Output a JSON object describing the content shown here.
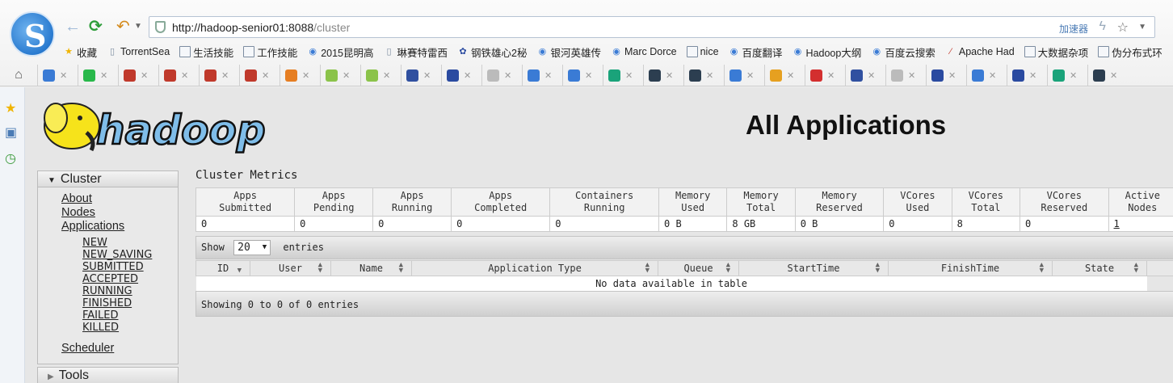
{
  "browser": {
    "url_host": "http://hadoop-senior01:8088",
    "url_path": "/cluster",
    "accelerator_label": "加速器",
    "bookmarks": [
      {
        "label": "收藏",
        "icon": "star-icon"
      },
      {
        "label": "TorrentSea",
        "icon": "page-icon"
      },
      {
        "label": "生活技能",
        "icon": "folder-icon"
      },
      {
        "label": "工作技能",
        "icon": "folder-icon"
      },
      {
        "label": "2015昆明高",
        "icon": "site-icon"
      },
      {
        "label": "琳賽特雷西",
        "icon": "page-icon"
      },
      {
        "label": "钢铁雄心2秘",
        "icon": "paw-icon"
      },
      {
        "label": "银河英雄传",
        "icon": "site-icon"
      },
      {
        "label": "Marc Dorce",
        "icon": "site-icon"
      },
      {
        "label": "nice",
        "icon": "folder-icon"
      },
      {
        "label": "百度翻译",
        "icon": "site-icon"
      },
      {
        "label": "Hadoop大纲",
        "icon": "site-icon"
      },
      {
        "label": "百度云搜索",
        "icon": "site-icon"
      },
      {
        "label": "Apache Had",
        "icon": "feather-icon"
      },
      {
        "label": "大数据杂项",
        "icon": "folder-icon"
      },
      {
        "label": "伪分布式环",
        "icon": "folder-icon"
      }
    ],
    "tab_colors": [
      "#3a7bd5",
      "#28b84a",
      "#c0392b",
      "#c0392b",
      "#c0392b",
      "#c0392b",
      "#e67e22",
      "#8bc34a",
      "#8bc34a",
      "#3050a0",
      "#2a4aa0",
      "#bbb",
      "#3a7bd5",
      "#3a7bd5",
      "#1aa37a",
      "#2c3e50",
      "#2c3e50",
      "#3a7bd5",
      "#e6a020",
      "#d32f2f",
      "#3050a0",
      "#bbb",
      "#2a4aa0",
      "#3a7bd5",
      "#2a4aa0",
      "#1aa37a",
      "#2c3e50"
    ]
  },
  "page": {
    "title": "All Applications",
    "nav": {
      "cluster_label": "Cluster",
      "links": [
        "About",
        "Nodes",
        "Applications"
      ],
      "app_states": [
        "NEW",
        "NEW_SAVING",
        "SUBMITTED",
        "ACCEPTED",
        "RUNNING",
        "FINISHED",
        "FAILED",
        "KILLED"
      ],
      "scheduler_label": "Scheduler",
      "tools_label": "Tools"
    },
    "cluster_metrics": {
      "title": "Cluster Metrics",
      "headers": [
        [
          "Apps",
          "Submitted"
        ],
        [
          "Apps",
          "Pending"
        ],
        [
          "Apps",
          "Running"
        ],
        [
          "Apps",
          "Completed"
        ],
        [
          "Containers",
          "Running"
        ],
        [
          "Memory",
          "Used"
        ],
        [
          "Memory",
          "Total"
        ],
        [
          "Memory",
          "Reserved"
        ],
        [
          "VCores",
          "Used"
        ],
        [
          "VCores",
          "Total"
        ],
        [
          "VCores",
          "Reserved"
        ],
        [
          "Active",
          "Nodes"
        ]
      ],
      "values": [
        "0",
        "0",
        "0",
        "0",
        "0",
        "0 B",
        "8 GB",
        "0 B",
        "0",
        "8",
        "0",
        "1"
      ]
    },
    "table": {
      "show_label": "Show",
      "entries_value": "20",
      "entries_label": "entries",
      "columns": [
        "ID",
        "User",
        "Name",
        "Application Type",
        "Queue",
        "StartTime",
        "FinishTime",
        "State"
      ],
      "empty_message": "No data available in table",
      "footer_info": "Showing 0 to 0 of 0 entries"
    }
  }
}
